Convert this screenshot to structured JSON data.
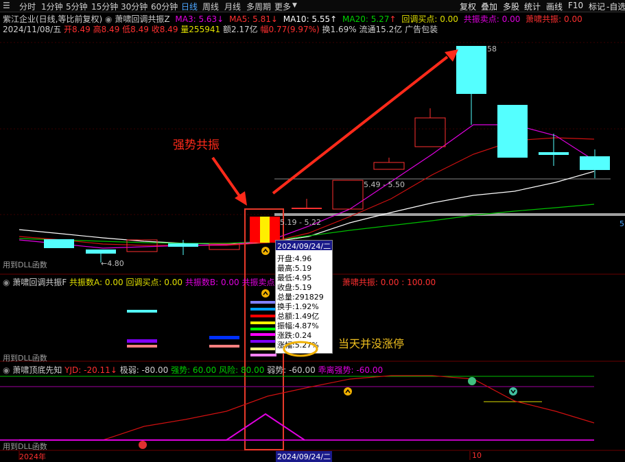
{
  "toolbar": {
    "periods": [
      "分时",
      "1分钟",
      "5分钟",
      "15分钟",
      "30分钟",
      "60分钟",
      "日线",
      "周线",
      "月线",
      "多周期",
      "更多"
    ],
    "active_period": "日线",
    "right_buttons": [
      "复权",
      "叠加",
      "多股",
      "统计",
      "画线",
      "F10",
      "标记",
      "-自选"
    ]
  },
  "header": {
    "stock": "紫江企业(日线,等比前复权)",
    "indicator": "萧啸回调共振Z",
    "ma3": "MA3: 5.63",
    "ma5": "MA5: 5.81",
    "ma10": "MA10: 5.55",
    "ma20": "MA20: 5.27",
    "buy": "回调买点: 0.00",
    "sell": "共振卖点: 0.00",
    "resonance": "萧啸共振: 0.00"
  },
  "quote": {
    "date": "2024/11/08/五",
    "open": "开8.49",
    "high": "高8.49",
    "low": "低8.49",
    "close": "收8.49",
    "volume": "量255941",
    "amount": "额2.17亿",
    "change": "幅0.77(9.97%)",
    "turnover": "换1.69%",
    "float": "流通15.2亿",
    "ad": "广告包装"
  },
  "price_labels": {
    "top": "58",
    "low": "4.80",
    "gap1": "5.49 - 5.50",
    "gap2": "5.19 - 5.22",
    "right_edge": "5"
  },
  "annotations": {
    "strong": "强势共振",
    "note": "当天并没涨停"
  },
  "dll_labels": [
    "用到DLL函数",
    "用到DLL函数",
    "用到DLL函数"
  ],
  "panel2": {
    "name": "萧啸回调共振F",
    "a": "共振数A: 0.00",
    "buy": "回调买点: 0.00",
    "b": "共振数B: 0.00",
    "sell": "共振卖点: 0.00",
    "res": "萧啸共振: 0.00 : 100.00"
  },
  "panel3": {
    "name": "萧啸顶底先知",
    "yjd": "YJD: -20.11",
    "ji": "极弱: -80.00",
    "strong": "强势: 60.00",
    "risk": "风险: 80.00",
    "weak": "弱势: -60.00",
    "deviate": "乖离强势: -60.00"
  },
  "tooltip": {
    "date": "2024/09/24/二",
    "rows": [
      "开盘:4.96",
      "最高:5.19",
      "最低:4.95",
      "收盘:5.19",
      "总量:291829",
      "换手:1.92%",
      "总额:1.49亿",
      "振幅:4.87%",
      "涨跌:0.24",
      "涨幅:5.27%"
    ]
  },
  "axis": {
    "year": "2024年",
    "date": "2024/09/24/二",
    "month": "10"
  },
  "colors": {
    "up": "#ff3030",
    "down": "#54ffff",
    "ma3": "#e000e0",
    "ma5": "#ff0000",
    "ma10": "#ffffff",
    "ma20": "#00c000",
    "box": "#e83a2a",
    "circle": "#f0b000"
  }
}
